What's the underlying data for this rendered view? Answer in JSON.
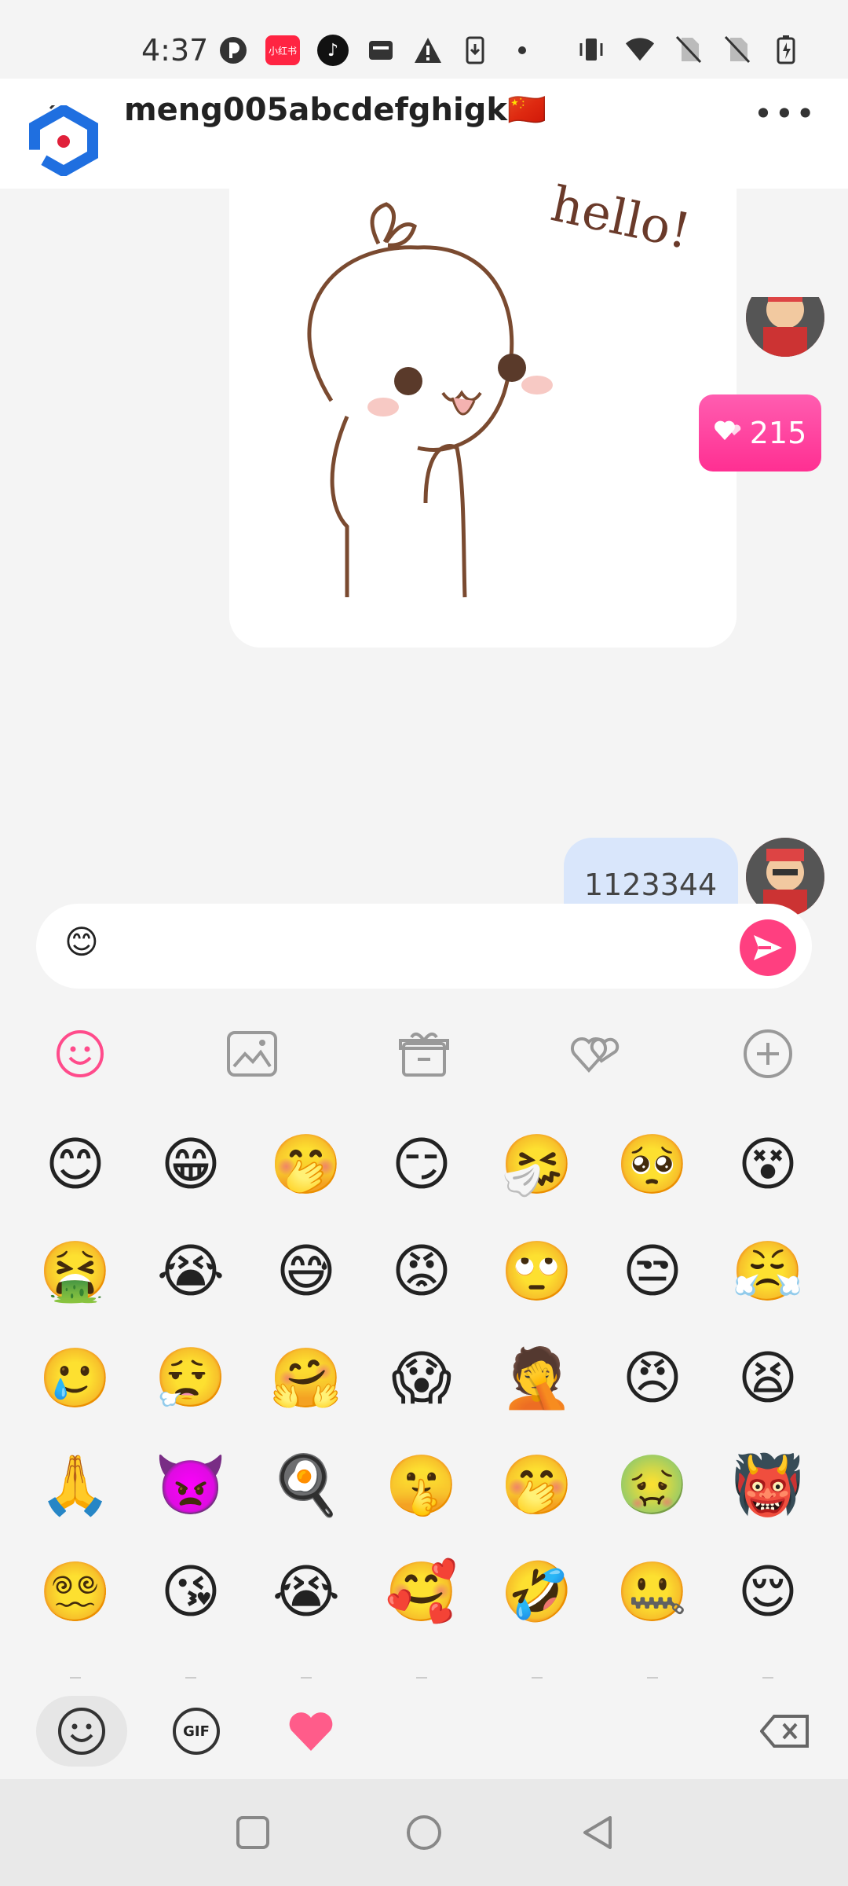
{
  "status_bar": {
    "time": "4:37",
    "left_icons": [
      "app-circle-icon",
      "xiaohongshu-icon",
      "tiktok-icon",
      "wallet-icon",
      "warning-icon",
      "download-icon",
      "dot-icon"
    ],
    "xiaohongshu_label": "小红书",
    "right_icons": [
      "vibrate-icon",
      "wifi-icon",
      "no-sim-icon",
      "no-sim-icon-2",
      "battery-charging-icon"
    ]
  },
  "header": {
    "contact_name": "meng005abcdefghigk🇨🇳",
    "more_label": "•••"
  },
  "chat": {
    "sticker_text": "hello!",
    "likes_count": "215",
    "message_text": "1123344"
  },
  "input": {
    "current_value": "😊",
    "send_icon": "send-icon"
  },
  "toolbar": {
    "items": [
      "emoji-icon",
      "image-icon",
      "gift-icon",
      "heart-chat-icon",
      "add-icon"
    ]
  },
  "emoji_grid": {
    "rows": [
      [
        "😊",
        "😁",
        "🤭",
        "😏",
        "🤧",
        "🥺",
        "😵"
      ],
      [
        "🤮",
        "😭",
        "😅",
        "😡",
        "🙄",
        "😒",
        "😤"
      ],
      [
        "🥲",
        "😮‍💨",
        "🤗",
        "😱",
        "🤦",
        "😠",
        "😫"
      ],
      [
        "🙏",
        "👿",
        "🍳",
        "🤫",
        "🤭",
        "🤢",
        "👹"
      ],
      [
        "😵‍💫",
        "😘",
        "😭",
        "🥰",
        "🤣",
        "🤐",
        "😌"
      ]
    ]
  },
  "emoji_tabs": {
    "items": [
      "smiley-tab-icon",
      "gif-tab-icon",
      "heart-tab-icon",
      "backspace-icon"
    ],
    "gif_label": "GIF"
  },
  "nav_bar": {
    "items": [
      "recents-icon",
      "home-icon",
      "back-icon"
    ]
  },
  "colors": {
    "accent_pink": "#ff3f80",
    "bubble_blue": "#d9e6fb",
    "likes_pink": "#ff4fa6"
  }
}
